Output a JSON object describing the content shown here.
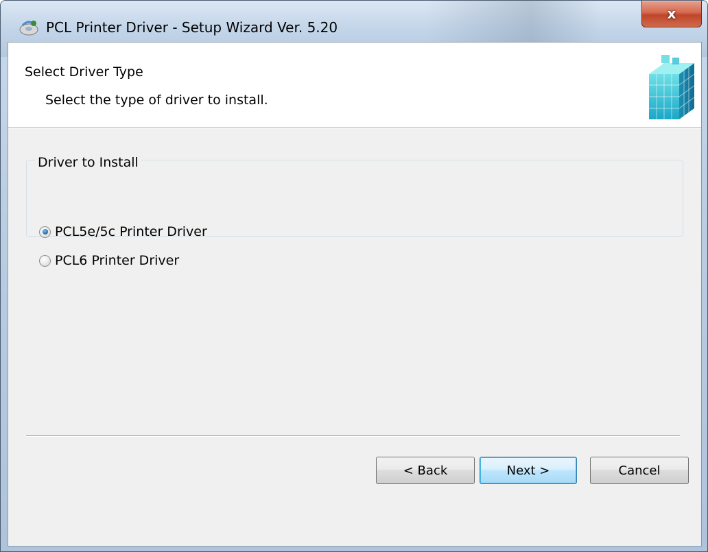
{
  "window": {
    "title": "PCL Printer Driver - Setup Wizard Ver. 5.20",
    "close_glyph": "x"
  },
  "header": {
    "title": "Select Driver Type",
    "subtitle": "Select the type of driver to install.",
    "icon": "cube-stack-icon"
  },
  "group": {
    "label": "Driver to Install",
    "options": [
      {
        "label": "PCL5e/5c Printer Driver",
        "selected": true
      },
      {
        "label": "PCL6 Printer Driver",
        "selected": false
      }
    ]
  },
  "buttons": {
    "back": "< Back",
    "next": "Next >",
    "cancel": "Cancel"
  },
  "colors": {
    "close_button": "#c0452a",
    "default_button_border": "#3c7fb1",
    "radio_dot": "#2a6fb0"
  }
}
